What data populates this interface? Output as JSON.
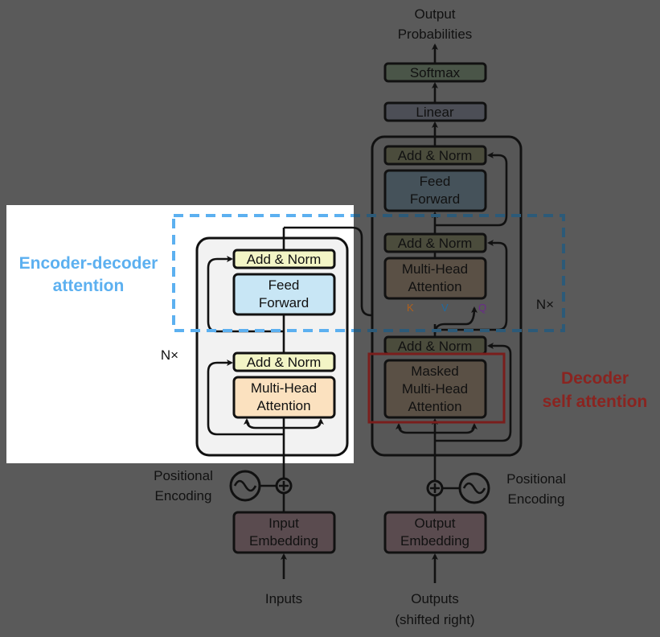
{
  "output": {
    "line1": "Output",
    "line2": "Probabilities"
  },
  "decoder": {
    "softmax": "Softmax",
    "linear": "Linear",
    "add_norm": "Add & Norm",
    "feed_forward": [
      "Feed",
      "Forward"
    ],
    "multi_head": [
      "Multi-Head",
      "Attention"
    ],
    "masked": [
      "Masked",
      "Multi-Head",
      "Attention"
    ],
    "k": "K",
    "v": "V",
    "q": "Q",
    "nx": "N×",
    "pos_enc": [
      "Positional",
      "Encoding"
    ],
    "embedding": [
      "Output",
      "Embedding"
    ],
    "inputs": [
      "Outputs",
      "(shifted right)"
    ]
  },
  "encoder": {
    "add_norm": "Add & Norm",
    "feed_forward": [
      "Feed",
      "Forward"
    ],
    "multi_head": [
      "Multi-Head",
      "Attention"
    ],
    "nx": "N×",
    "pos_enc": [
      "Positional",
      "Encoding"
    ],
    "embedding": [
      "Input",
      "Embedding"
    ],
    "inputs": "Inputs"
  },
  "annotations": {
    "enc_dec": [
      "Encoder-decoder",
      "attention"
    ],
    "dec_self": [
      "Decoder",
      "self attention"
    ]
  },
  "colors": {
    "highlight_blue": "#5cb0f0",
    "highlight_red": "#8a2420",
    "dim_overlay": "#5a5a5a"
  }
}
